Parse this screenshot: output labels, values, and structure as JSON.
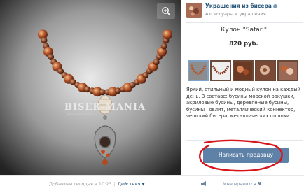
{
  "store": {
    "name": "Украшения из бисера",
    "subtitle": "Аксессуары и украшения"
  },
  "product": {
    "title": "Кулон \"Safari\"",
    "price": "820 руб.",
    "description": "Яркий, стильный и модный кулон на каждый день. В составе: бусины морской ракушки, акриловые бусины, деревянные бусины, бусины Говлит, металлический коннектор, чешский бисера, металлических шляпки.",
    "contact_button": "Написать продавцу"
  },
  "photo": {
    "watermark": "BISER-MANIA",
    "watermark_sub": "www.biser-mania.ru"
  },
  "footer": {
    "added": "Добавлен сегодня в 10:23",
    "actions": "Действия",
    "like": "Мне нравится"
  },
  "colors": {
    "button": "#5e81a8",
    "link": "#2b587a",
    "annotation": "#d8141b"
  },
  "icons": {
    "zoom": "zoom-in-icon",
    "share": "megaphone-icon",
    "like": "heart-icon"
  }
}
